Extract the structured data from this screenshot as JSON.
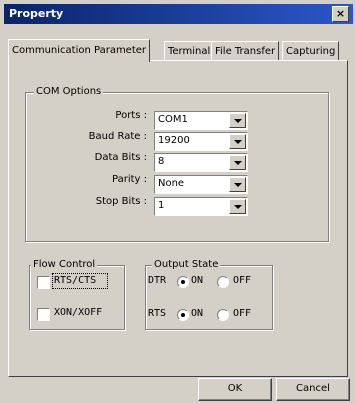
{
  "window": {
    "title": "Property",
    "close_label": "×"
  },
  "tabs": [
    {
      "label": "Communication Parameter",
      "active": true
    },
    {
      "label": "Terminal",
      "active": false
    },
    {
      "label": "File Transfer",
      "active": false
    },
    {
      "label": "Capturing",
      "active": false
    }
  ],
  "com_options": {
    "title": "COM Options",
    "fields": [
      {
        "label": "Ports :",
        "value": "COM1"
      },
      {
        "label": "Baud Rate :",
        "value": "19200"
      },
      {
        "label": "Data Bits :",
        "value": "8"
      },
      {
        "label": "Parity :",
        "value": "None"
      },
      {
        "label": "Stop Bits :",
        "value": "1"
      }
    ]
  },
  "flow_control": {
    "title": "Flow Control",
    "rts_cts": {
      "label": "RTS/CTS",
      "checked": false
    },
    "xon_xoff": {
      "label": "XON/XOFF",
      "checked": false
    }
  },
  "output_state": {
    "title": "Output State",
    "dtr": {
      "label": "DTR",
      "on_label": "ON",
      "off_label": "OFF",
      "selected": "ON"
    },
    "rts": {
      "label": "RTS",
      "on_label": "ON",
      "off_label": "OFF",
      "selected": "ON"
    }
  },
  "buttons": {
    "ok": "OK",
    "cancel": "Cancel"
  }
}
